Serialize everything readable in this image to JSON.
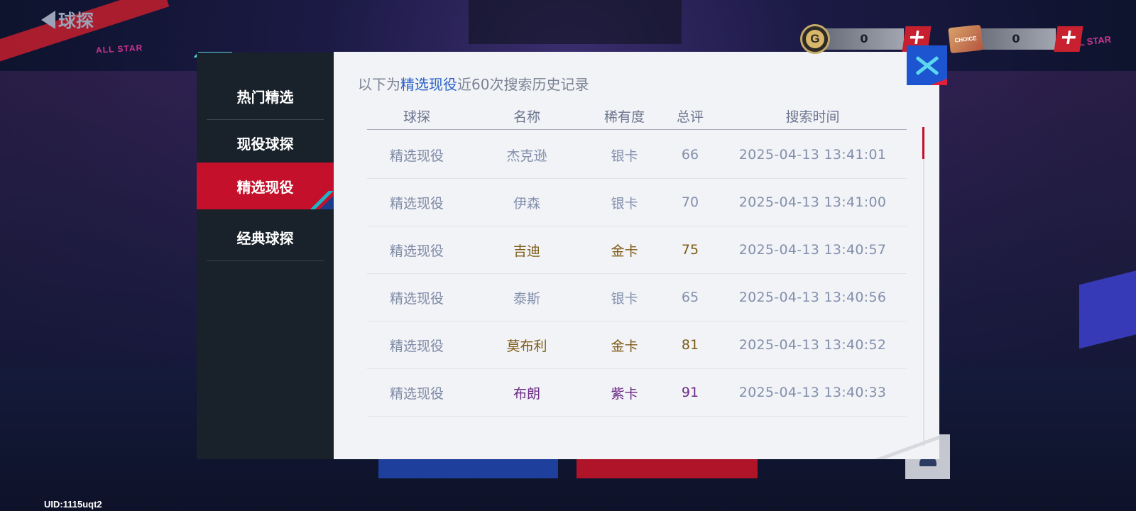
{
  "topbar": {
    "title": "球探",
    "back_icon": "back-arrow-icon"
  },
  "currencies": [
    {
      "icon": "g-coin-icon",
      "icon_text": "G",
      "value": "0"
    },
    {
      "icon": "choice-ticket-icon",
      "icon_text": "CHOICE",
      "value": "0"
    }
  ],
  "sidebar": {
    "items": [
      {
        "label": "热门精选",
        "active": false
      },
      {
        "label": "现役球探",
        "active": false
      },
      {
        "label": "精选现役",
        "active": true
      },
      {
        "label": "经典球探",
        "active": false
      }
    ]
  },
  "header": {
    "prefix": "以下为",
    "highlight": "精选现役",
    "suffix": "近60次搜索历史记录"
  },
  "table": {
    "columns": [
      "球探",
      "名称",
      "稀有度",
      "总评",
      "搜索时间"
    ],
    "rows": [
      {
        "scout": "精选现役",
        "name": "杰克逊",
        "rarity": "银卡",
        "rating": "66",
        "time": "2025-04-13 13:41:01",
        "tier": "silver"
      },
      {
        "scout": "精选现役",
        "name": "伊森",
        "rarity": "银卡",
        "rating": "70",
        "time": "2025-04-13 13:41:00",
        "tier": "silver"
      },
      {
        "scout": "精选现役",
        "name": "吉迪",
        "rarity": "金卡",
        "rating": "75",
        "time": "2025-04-13 13:40:57",
        "tier": "gold"
      },
      {
        "scout": "精选现役",
        "name": "泰斯",
        "rarity": "银卡",
        "rating": "65",
        "time": "2025-04-13 13:40:56",
        "tier": "silver"
      },
      {
        "scout": "精选现役",
        "name": "莫布利",
        "rarity": "金卡",
        "rating": "81",
        "time": "2025-04-13 13:40:52",
        "tier": "gold"
      },
      {
        "scout": "精选现役",
        "name": "布朗",
        "rarity": "紫卡",
        "rating": "91",
        "time": "2025-04-13 13:40:33",
        "tier": "purple"
      }
    ]
  },
  "colors": {
    "accent_red": "#c4102a",
    "close_blue": "#1c55cf",
    "highlight_blue": "#2b62c9",
    "gold_text": "#7d5a16",
    "silver_text": "#8290ad",
    "purple_text": "#6b2a86"
  },
  "footer": {
    "uid": "UID:1115uqt2"
  },
  "background": {
    "allstar_text": "ALL STAR"
  }
}
